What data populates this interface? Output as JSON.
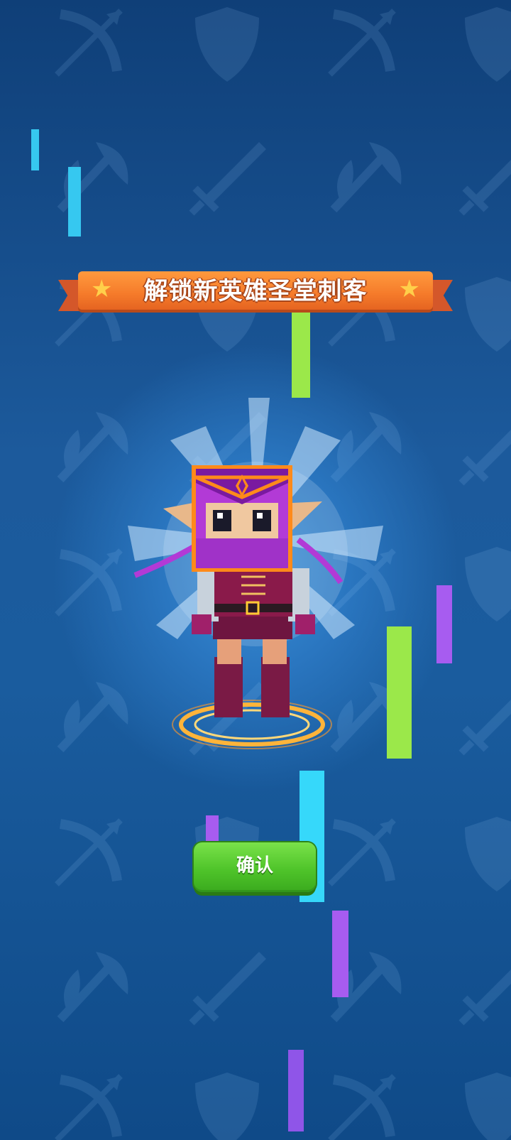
{
  "banner": {
    "title": "解锁新英雄圣堂刺客"
  },
  "confirm_button": {
    "label": "确认"
  },
  "colors": {
    "background_top": "#0f3f78",
    "background_mid": "#1c5a9c",
    "banner_orange": "#f57a2a",
    "banner_star": "#ffcf4a",
    "button_green": "#4fc42a",
    "streak_cyan": "#36c8f0",
    "streak_green": "#9be84a",
    "streak_purple": "#a75cf0"
  },
  "background_pattern_icons": [
    "bow-icon",
    "shield-icon",
    "axe-icon",
    "sword-icon"
  ],
  "hero": {
    "icon": "assassin-hero-character"
  }
}
